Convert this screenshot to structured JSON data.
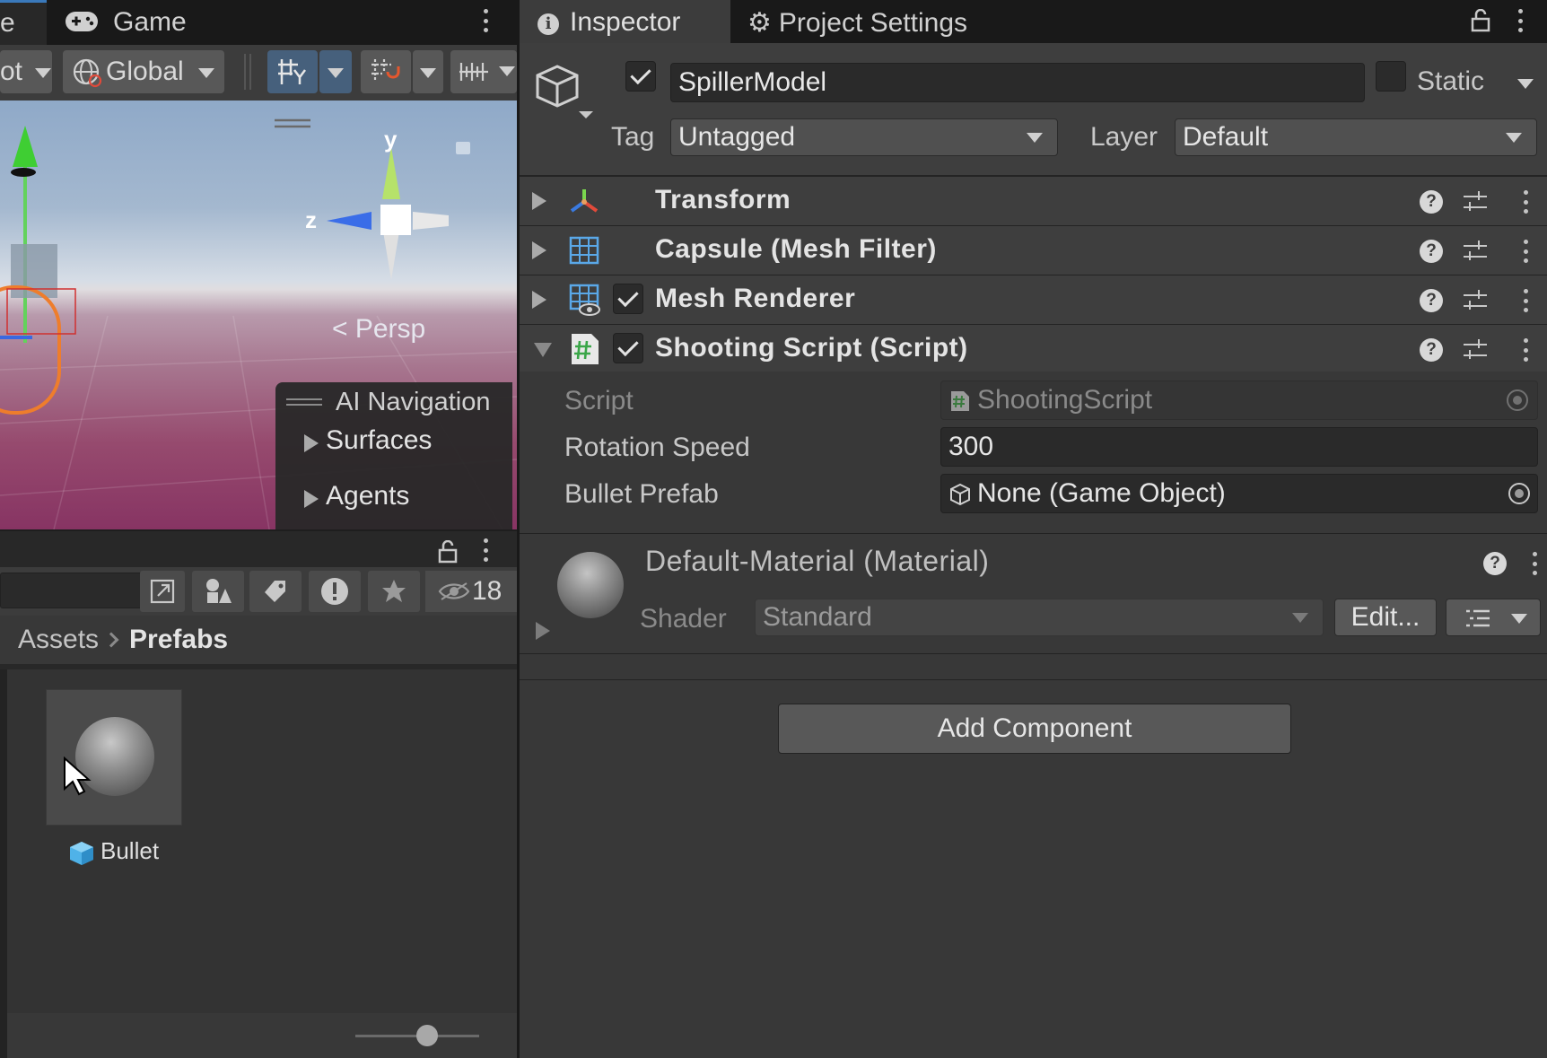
{
  "scene": {
    "tab_fragment": "e",
    "game_tab": "Game",
    "toolbar": {
      "pivot_fragment": "ot",
      "global_label": "Global"
    },
    "gizmo_labels": {
      "y": "y",
      "z": "z"
    },
    "persp_label": "< Persp",
    "ai_navigation": {
      "title": "AI Navigation",
      "items": [
        "Surfaces",
        "Agents"
      ]
    }
  },
  "project": {
    "hidden_count": "18",
    "breadcrumb": {
      "root": "Assets",
      "current": "Prefabs"
    },
    "assets": [
      {
        "label": "Bullet",
        "icon": "prefab-cube-icon"
      }
    ]
  },
  "inspector": {
    "tabs": {
      "inspector": "Inspector",
      "project_settings": "Project Settings"
    },
    "gameobject": {
      "name": "SpillerModel",
      "active": true,
      "static_label": "Static",
      "tag_label": "Tag",
      "tag_value": "Untagged",
      "layer_label": "Layer",
      "layer_value": "Default"
    },
    "components": [
      {
        "title": "Transform",
        "icon": "transform-axes-icon",
        "has_toggle": false,
        "expanded": false
      },
      {
        "title": "Capsule (Mesh Filter)",
        "icon": "mesh-filter-grid-icon",
        "has_toggle": false,
        "expanded": false
      },
      {
        "title": "Mesh Renderer",
        "icon": "mesh-renderer-icon",
        "has_toggle": true,
        "expanded": false
      },
      {
        "title": "Shooting Script (Script)",
        "icon": "csharp-script-icon",
        "has_toggle": true,
        "expanded": true
      }
    ],
    "script_fields": {
      "script_label": "Script",
      "script_value": "ShootingScript",
      "rotation_label": "Rotation Speed",
      "rotation_value": "300",
      "bullet_label": "Bullet Prefab",
      "bullet_value": "None (Game Object)"
    },
    "material": {
      "title": "Default-Material (Material)",
      "shader_label": "Shader",
      "shader_value": "Standard",
      "edit_button": "Edit..."
    },
    "add_component": "Add Component"
  },
  "colors": {
    "accent_blue": "#3a79bb",
    "panel_bg": "#383838",
    "header_bg": "#3e3e3e",
    "tab_bar": "#191919"
  }
}
